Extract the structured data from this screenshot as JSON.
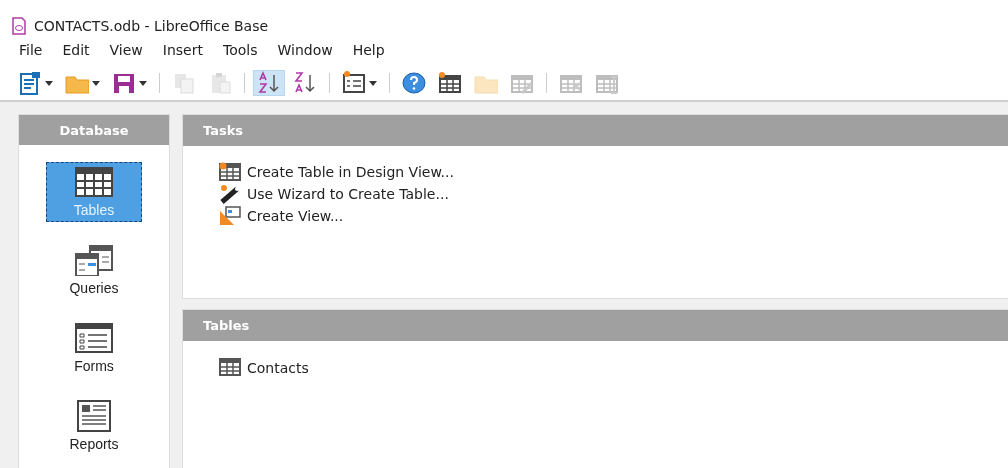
{
  "window": {
    "title": "CONTACTS.odb - LibreOffice Base"
  },
  "menu": [
    "File",
    "Edit",
    "View",
    "Insert",
    "Tools",
    "Window",
    "Help"
  ],
  "toolbar": [
    {
      "kind": "new-doc",
      "disabled": false,
      "on": false,
      "dropdown": true
    },
    {
      "kind": "open",
      "disabled": false,
      "on": false,
      "dropdown": true
    },
    {
      "kind": "save",
      "disabled": false,
      "on": false,
      "dropdown": true
    },
    {
      "kind": "separator"
    },
    {
      "kind": "copy",
      "disabled": true,
      "on": false,
      "dropdown": false
    },
    {
      "kind": "paste",
      "disabled": true,
      "on": false,
      "dropdown": false
    },
    {
      "kind": "separator"
    },
    {
      "kind": "sort-asc",
      "disabled": false,
      "on": true,
      "dropdown": false
    },
    {
      "kind": "sort-desc",
      "disabled": false,
      "on": false,
      "dropdown": false
    },
    {
      "kind": "separator"
    },
    {
      "kind": "form",
      "disabled": false,
      "on": false,
      "dropdown": true
    },
    {
      "kind": "separator"
    },
    {
      "kind": "help",
      "disabled": false,
      "on": false,
      "dropdown": false
    },
    {
      "kind": "new-table",
      "disabled": false,
      "on": false,
      "dropdown": false
    },
    {
      "kind": "open",
      "disabled": true,
      "on": false,
      "dropdown": false
    },
    {
      "kind": "edit-table",
      "disabled": true,
      "on": false,
      "dropdown": false
    },
    {
      "kind": "separator"
    },
    {
      "kind": "delete-table",
      "disabled": true,
      "on": false,
      "dropdown": false
    },
    {
      "kind": "rename-table",
      "disabled": true,
      "on": false,
      "dropdown": false
    }
  ],
  "sidebar": {
    "title": "Database",
    "items": [
      {
        "label": "Tables",
        "kind": "tables",
        "selected": true
      },
      {
        "label": "Queries",
        "kind": "queries",
        "selected": false
      },
      {
        "label": "Forms",
        "kind": "forms",
        "selected": false
      },
      {
        "label": "Reports",
        "kind": "reports",
        "selected": false
      }
    ]
  },
  "tasks": {
    "title": "Tasks",
    "items": [
      {
        "label": "Create Table in Design View...",
        "kind": "design"
      },
      {
        "label": "Use Wizard to Create Table...",
        "kind": "wizard"
      },
      {
        "label": "Create View...",
        "kind": "view"
      }
    ]
  },
  "tables": {
    "title": "Tables",
    "items": [
      {
        "label": "Contacts"
      }
    ]
  }
}
